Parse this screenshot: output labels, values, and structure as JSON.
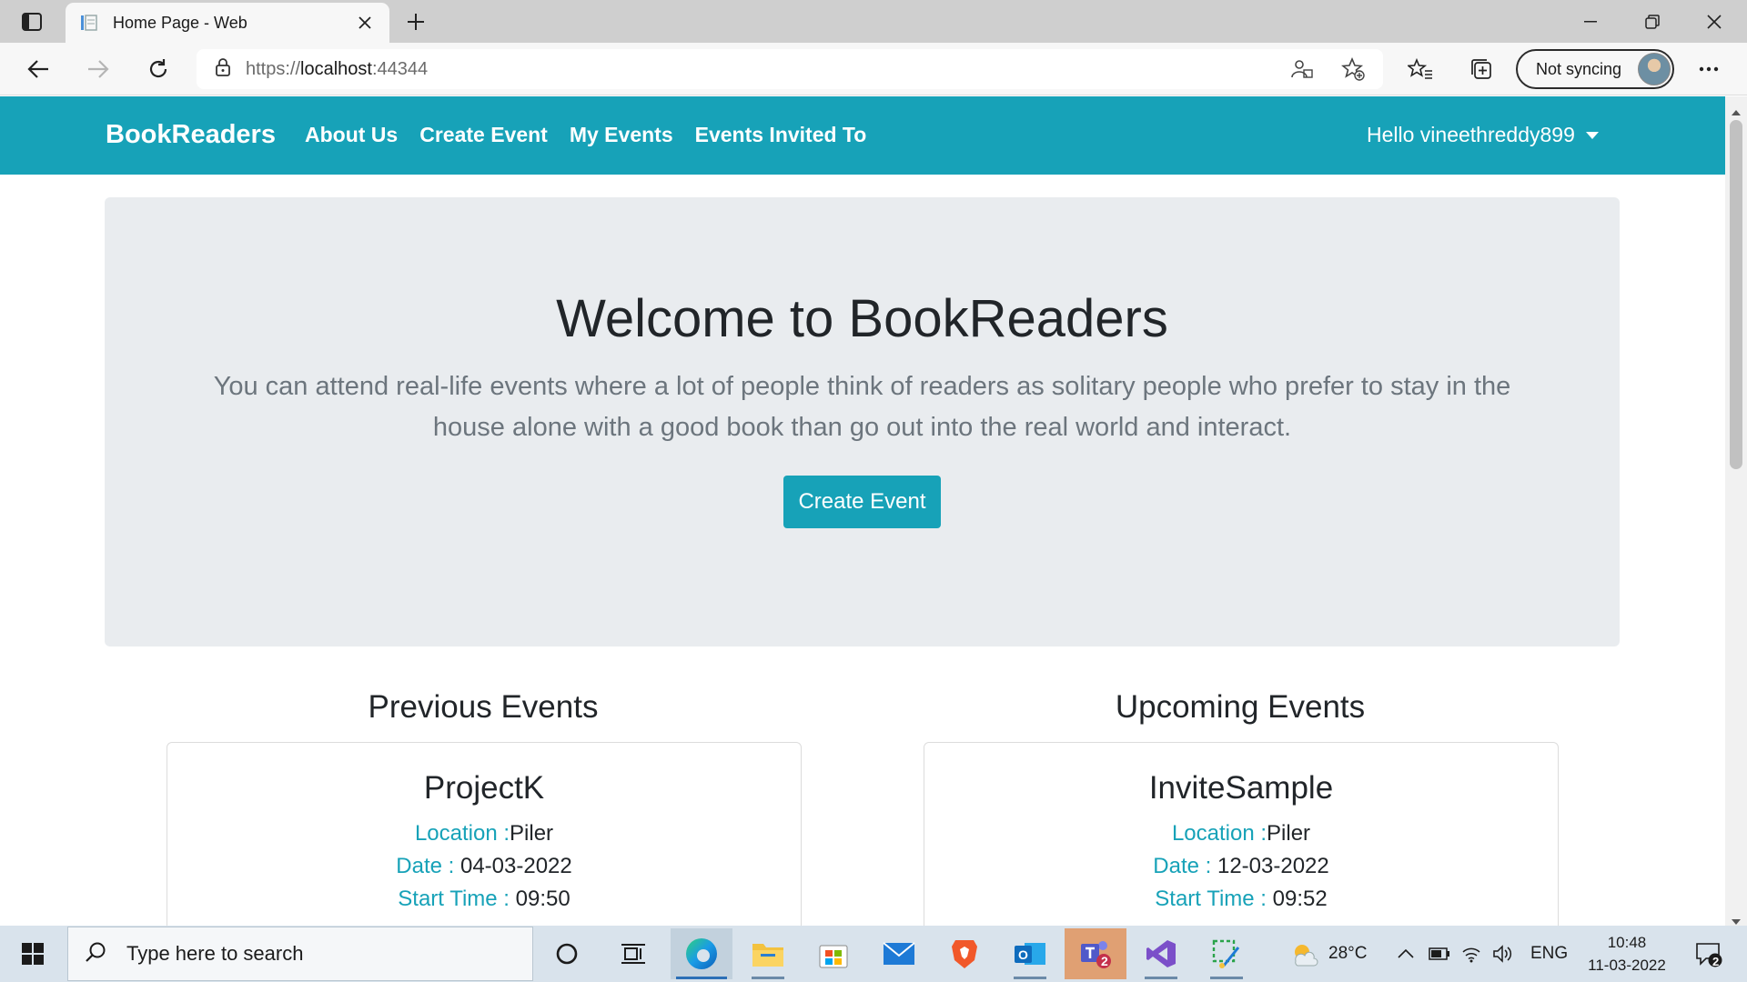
{
  "browser": {
    "tab_title": "Home Page - Web",
    "url_scheme": "https://",
    "url_host": "localhost",
    "url_port": ":44344",
    "sync_label": "Not syncing"
  },
  "navbar": {
    "brand": "BookReaders",
    "links": [
      "About Us",
      "Create Event",
      "My Events",
      "Events Invited To"
    ],
    "user_greeting": "Hello vineethreddy899"
  },
  "jumbotron": {
    "title": "Welcome to BookReaders",
    "lead": "You can attend real-life events where a lot of people think of readers as solitary people who prefer to stay in the house alone with a good book than go out into the real world and interact.",
    "button_label": "Create Event"
  },
  "previous_events": {
    "heading": "Previous Events",
    "card": {
      "title": "ProjectK",
      "location_key": "Location :",
      "location": "Piler",
      "date_key": "Date : ",
      "date": "04-03-2022",
      "start_key": "Start Time : ",
      "start_time": "09:50"
    }
  },
  "upcoming_events": {
    "heading": "Upcoming Events",
    "card": {
      "title": "InviteSample",
      "location_key": "Location :",
      "location": "Piler",
      "date_key": "Date : ",
      "date": "12-03-2022",
      "start_key": "Start Time : ",
      "start_time": "09:52"
    }
  },
  "taskbar": {
    "search_placeholder": "Type here to search",
    "teams_badge": "2",
    "weather": "28°C",
    "language": "ENG",
    "time": "10:48",
    "date": "11-03-2022",
    "notification_count": "2"
  },
  "colors": {
    "accent": "#17a2b8",
    "jumbotron_bg": "#e9ecef",
    "text_dark": "#212529",
    "text_muted": "#6c757d"
  }
}
